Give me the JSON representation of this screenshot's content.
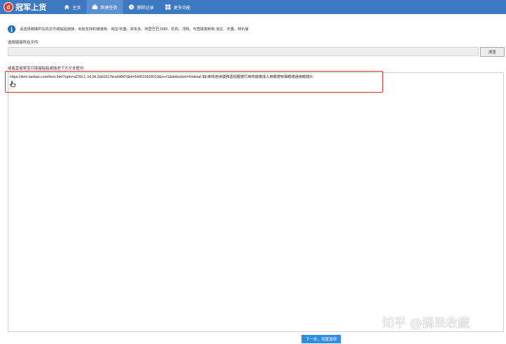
{
  "app": {
    "title": "冠军上货",
    "logo_glyph": "d"
  },
  "nav": [
    {
      "label": "主页",
      "icon": "home-icon",
      "active": false
    },
    {
      "label": "新建任务",
      "icon": "briefcase-icon",
      "active": true
    },
    {
      "label": "删除记录",
      "icon": "clock-icon",
      "active": false
    },
    {
      "label": "更多功能",
      "icon": "grid-icon",
      "active": false
    }
  ],
  "info": {
    "icon": "info-icon",
    "text": "请选择链接所在的文件或粘贴链接，目前支持的链接有：淘宝/天猫、拼多多、阿里巴巴1688、优购、洋购。可直接复制到 淘宝、天猫、特价版"
  },
  "file": {
    "label": "选择链接所在文件:",
    "value": "",
    "browse_label": "浏览"
  },
  "paste": {
    "label": "或者直接将宝贝链接粘贴或拖进下方文本框内:",
    "content": "https://item.taobao.com/item.htm?spm=a230r.1.14.34.2dd1517brwhKMY&id=644615629019&ns=1&abbucket=6#detail $$ 麻将连续摸牌透视眼镜打麻将摸牌成人用眼镜特殊眼镜通用眼镜片"
  },
  "actions": {
    "next_label": "下一步，设置选项"
  },
  "watermark": "知乎 @摘果收藏",
  "colors": {
    "topbar": "#3d78c0",
    "nav_active": "#5b8fcf",
    "highlight": "#e02a2a",
    "primary_button": "#2e8ee6"
  }
}
